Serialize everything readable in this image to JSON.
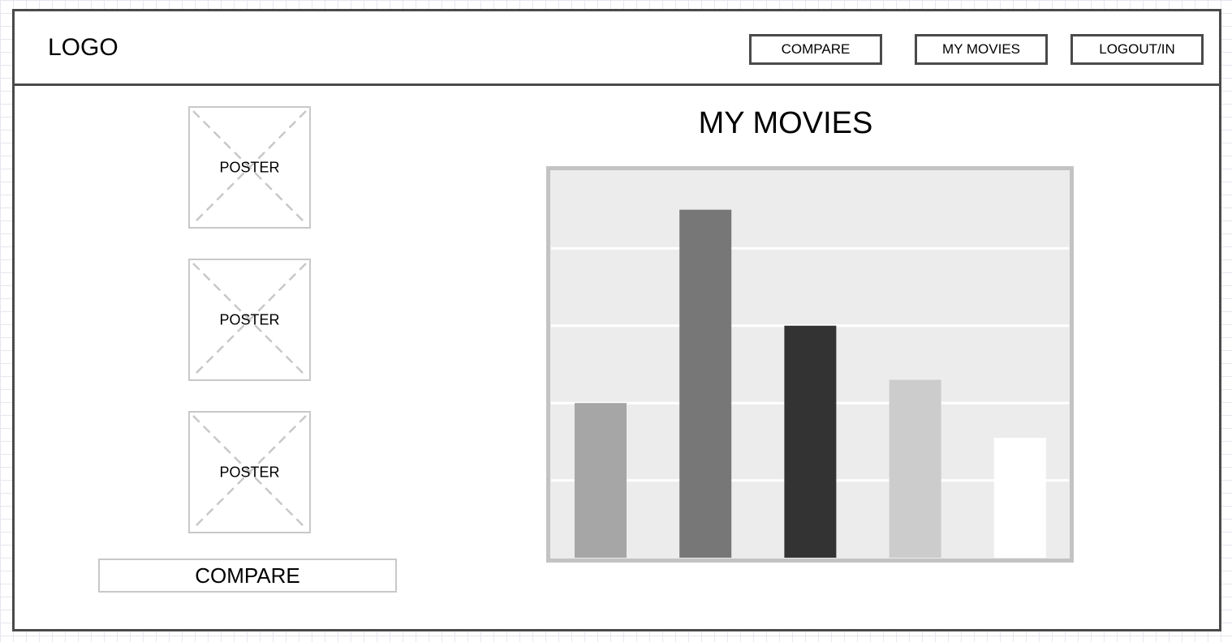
{
  "header": {
    "logo": "LOGO",
    "nav": [
      {
        "label": "COMPARE"
      },
      {
        "label": "MY MOVIES"
      },
      {
        "label": "LOGOUT/IN"
      }
    ]
  },
  "sidebar": {
    "posters": [
      {
        "label": "POSTER"
      },
      {
        "label": "POSTER"
      },
      {
        "label": "POSTER"
      }
    ],
    "compare_button": "COMPARE"
  },
  "main": {
    "title": "MY MOVIES"
  },
  "chart_data": {
    "type": "bar",
    "title": "",
    "xlabel": "",
    "ylabel": "",
    "categories": [
      "",
      "",
      "",
      "",
      ""
    ],
    "values": [
      2,
      4.5,
      3,
      2.3,
      1.55
    ],
    "colors": [
      "#a6a6a6",
      "#777777",
      "#333333",
      "#cccccc",
      "#ffffff"
    ],
    "ylim": [
      0,
      5
    ],
    "grid": true,
    "background": "#ececec",
    "border_color": "#c3c3c3"
  }
}
